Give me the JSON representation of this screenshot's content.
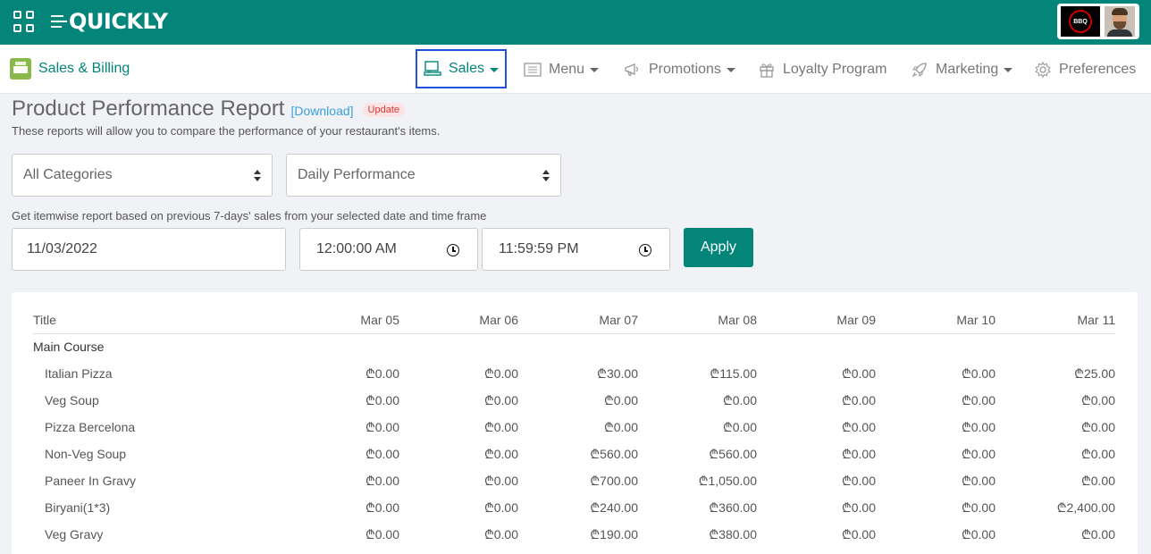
{
  "app": {
    "logo_text": "QUICKLY",
    "restaurant_logo_text": "BBQ"
  },
  "nav": {
    "brand": "Sales & Billing",
    "items": [
      {
        "label": "Sales",
        "icon": "pos-terminal-icon",
        "dropdown": true,
        "selected": true
      },
      {
        "label": "Menu",
        "icon": "menu-list-icon",
        "dropdown": true
      },
      {
        "label": "Promotions",
        "icon": "megaphone-icon",
        "dropdown": true
      },
      {
        "label": "Loyalty Program",
        "icon": "gift-icon",
        "dropdown": false
      },
      {
        "label": "Marketing",
        "icon": "rocket-icon",
        "dropdown": true
      },
      {
        "label": "Preferences",
        "icon": "gear-icon",
        "dropdown": false
      }
    ]
  },
  "page": {
    "title": "Product Performance Report",
    "download_label": "[Download]",
    "update_badge": "Update",
    "subtitle": "These reports will allow you to compare the performance of your restaurant's items."
  },
  "filters": {
    "category_value": "All Categories",
    "performance_value": "Daily Performance",
    "hint": "Get itemwise report based on previous 7-days' sales from your selected date and time frame",
    "date_value": "11/03/2022",
    "start_time": "12:00:00 AM",
    "end_time": "11:59:59 PM",
    "apply_label": "Apply"
  },
  "table": {
    "headers": [
      "Title",
      "Mar 05",
      "Mar 06",
      "Mar 07",
      "Mar 08",
      "Mar 09",
      "Mar 10",
      "Mar 11"
    ],
    "group": "Main Course",
    "rows": [
      {
        "name": "Italian Pizza",
        "values": [
          "₾0.00",
          "₾0.00",
          "₾30.00",
          "₾115.00",
          "₾0.00",
          "₾0.00",
          "₾25.00"
        ]
      },
      {
        "name": "Veg Soup",
        "values": [
          "₾0.00",
          "₾0.00",
          "₾0.00",
          "₾0.00",
          "₾0.00",
          "₾0.00",
          "₾0.00"
        ]
      },
      {
        "name": "Pizza Bercelona",
        "values": [
          "₾0.00",
          "₾0.00",
          "₾0.00",
          "₾0.00",
          "₾0.00",
          "₾0.00",
          "₾0.00"
        ]
      },
      {
        "name": "Non-Veg Soup",
        "values": [
          "₾0.00",
          "₾0.00",
          "₾560.00",
          "₾560.00",
          "₾0.00",
          "₾0.00",
          "₾0.00"
        ]
      },
      {
        "name": "Paneer In Gravy",
        "values": [
          "₾0.00",
          "₾0.00",
          "₾700.00",
          "₾1,050.00",
          "₾0.00",
          "₾0.00",
          "₾0.00"
        ]
      },
      {
        "name": "Biryani(1*3)",
        "values": [
          "₾0.00",
          "₾0.00",
          "₾240.00",
          "₾360.00",
          "₾0.00",
          "₾0.00",
          "₾2,400.00"
        ]
      },
      {
        "name": "Veg Gravy",
        "values": [
          "₾0.00",
          "₾0.00",
          "₾190.00",
          "₾380.00",
          "₾0.00",
          "₾0.00",
          "₾0.00"
        ]
      }
    ]
  }
}
